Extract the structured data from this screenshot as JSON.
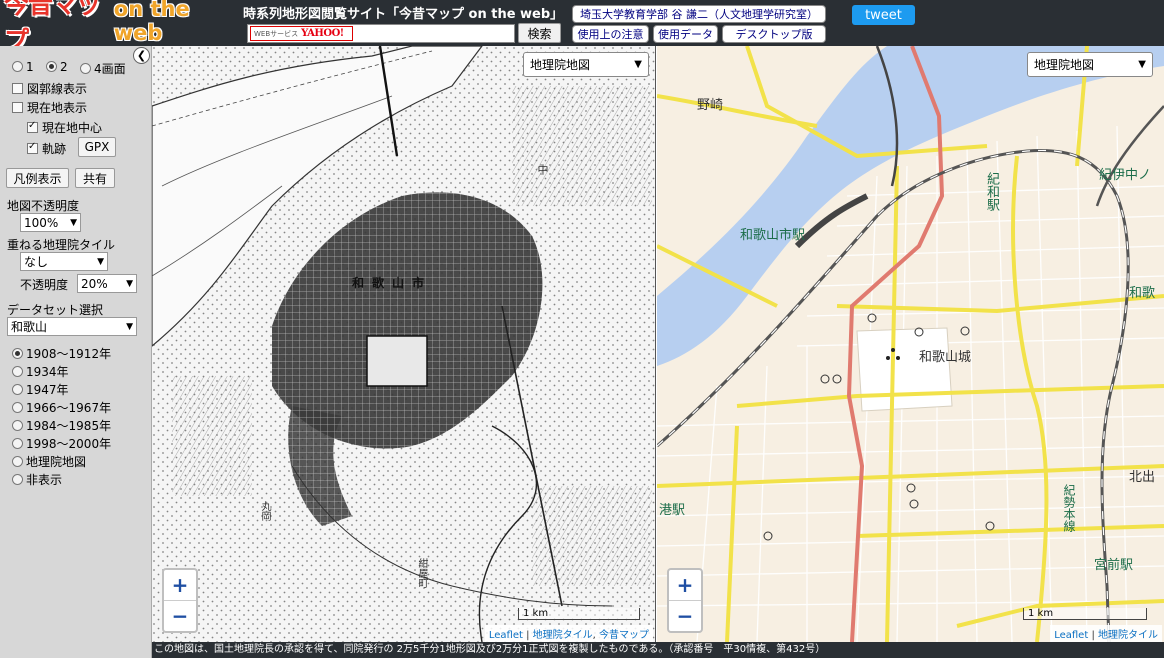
{
  "header": {
    "logo_main": "今昔マップ",
    "logo_sub": "on the web",
    "site_title": "時系列地形図閲覧サイト「今昔マップ on the web」",
    "badge_left": "WEBサービス",
    "badge_right": "YAHOO!",
    "search_value": "",
    "search_button": "検索",
    "author": "埼玉大学教育学部 谷 謙二（人文地理学研究室）",
    "btn_notes": "使用上の注意",
    "btn_data": "使用データ",
    "btn_desktop": "デスクトップ版",
    "tweet": "tweet"
  },
  "sidebar": {
    "screens": [
      {
        "label": "1",
        "checked": false
      },
      {
        "label": "2",
        "checked": true
      },
      {
        "label": "4画面",
        "checked": false
      }
    ],
    "show_frame": "図郭線表示",
    "show_current": "現在地表示",
    "center_current": "現在地中心",
    "track": "軌跡",
    "gpx_button": "GPX",
    "legend_button": "凡例表示",
    "share_button": "共有",
    "opacity_label": "地図不透明度",
    "opacity_value": "100%",
    "overlay_label": "重ねる地理院タイル",
    "overlay_value": "なし",
    "overlay_opacity_label": "不透明度",
    "overlay_opacity_value": "20%",
    "dataset_label": "データセット選択",
    "dataset_value": "和歌山",
    "eras": [
      {
        "label": "1908～1912年",
        "checked": true
      },
      {
        "label": "1934年",
        "checked": false
      },
      {
        "label": "1947年",
        "checked": false
      },
      {
        "label": "1966～1967年",
        "checked": false
      },
      {
        "label": "1984～1985年",
        "checked": false
      },
      {
        "label": "1998～2000年",
        "checked": false
      },
      {
        "label": "地理院地図",
        "checked": false
      },
      {
        "label": "非表示",
        "checked": false
      }
    ]
  },
  "left_map": {
    "layer_select": "地理院地図",
    "zoom_in": "+",
    "zoom_out": "−",
    "scale": "1 km",
    "attrib_leaflet": "Leaflet",
    "attrib_tile": "地理院タイル",
    "attrib_konjaku": "今昔マップ",
    "labels": {
      "city": "和歌山市",
      "naka": "中",
      "hill": "丸岡",
      "town": "紺屋町"
    }
  },
  "right_map": {
    "layer_select": "地理院地図",
    "zoom_in": "+",
    "zoom_out": "−",
    "scale": "1 km",
    "attrib_leaflet": "Leaflet",
    "attrib_tile": "地理院タイル",
    "labels": {
      "nozaki": "野崎",
      "wakayamashi_station": "和歌山市駅",
      "kii_station": "紀和駅",
      "kiinaka": "紀伊中ノ",
      "wakayama_castle": "和歌山城",
      "wa": "和歌",
      "kitade": "北出",
      "port_station": "港駅",
      "kisei_line": "紀勢本線",
      "miyamae_station": "宮前駅"
    }
  },
  "footer": {
    "text": "この地図は、国土地理院長の承認を得て、同院発行の 2万5千分1地形図及び2万分1正式図を複製したものである。（承認番号　平30情複、第432号）"
  }
}
